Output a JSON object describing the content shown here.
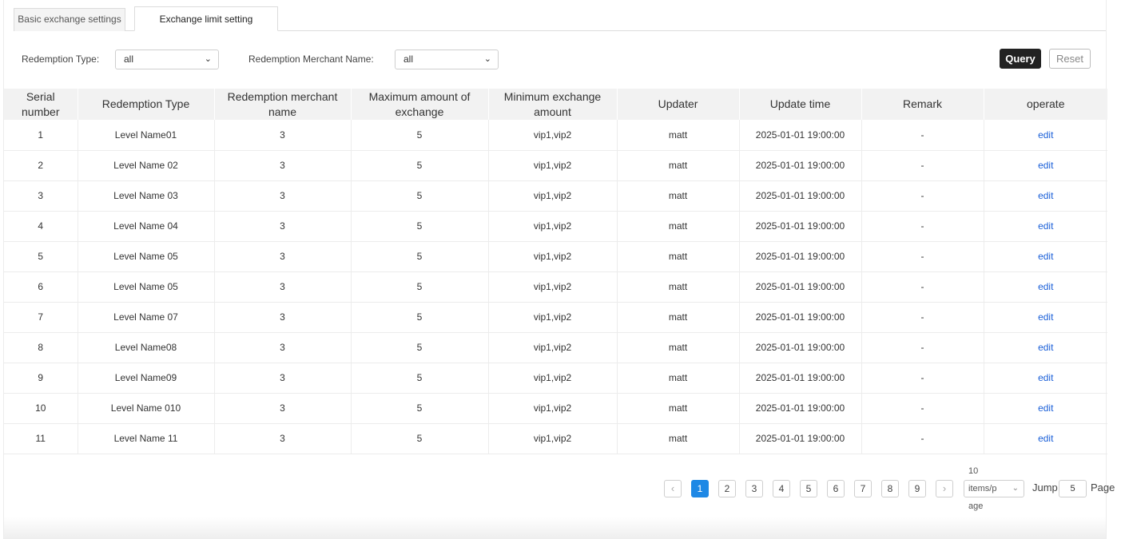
{
  "tabs": [
    {
      "label": "Basic exchange settings",
      "active": false
    },
    {
      "label": "Exchange limit setting",
      "active": true
    }
  ],
  "filters": {
    "redemption_type_label": "Redemption Type:",
    "redemption_type_value": "all",
    "merchant_name_label": "Redemption Merchant Name:",
    "merchant_name_value": "all",
    "query_label": "Query",
    "reset_label": "Reset"
  },
  "table": {
    "columns": [
      "Serial number",
      "Redemption Type",
      "Redemption merchant name",
      "Maximum amount of exchange",
      "Minimum exchange amount",
      "Updater",
      "Update time",
      "Remark",
      "operate"
    ],
    "rows": [
      [
        "1",
        "Level Name01",
        "3",
        "5",
        "vip1,vip2",
        "matt",
        "2025-01-01 19:00:00",
        "-",
        "edit"
      ],
      [
        "2",
        "Level Name 02",
        "3",
        "5",
        "vip1,vip2",
        "matt",
        "2025-01-01 19:00:00",
        "-",
        "edit"
      ],
      [
        "3",
        "Level Name 03",
        "3",
        "5",
        "vip1,vip2",
        "matt",
        "2025-01-01 19:00:00",
        "-",
        "edit"
      ],
      [
        "4",
        "Level Name 04",
        "3",
        "5",
        "vip1,vip2",
        "matt",
        "2025-01-01 19:00:00",
        "-",
        "edit"
      ],
      [
        "5",
        "Level Name 05",
        "3",
        "5",
        "vip1,vip2",
        "matt",
        "2025-01-01 19:00:00",
        "-",
        "edit"
      ],
      [
        "6",
        "Level Name 05",
        "3",
        "5",
        "vip1,vip2",
        "matt",
        "2025-01-01 19:00:00",
        "-",
        "edit"
      ],
      [
        "7",
        "Level Name 07",
        "3",
        "5",
        "vip1,vip2",
        "matt",
        "2025-01-01 19:00:00",
        "-",
        "edit"
      ],
      [
        "8",
        "Level Name08",
        "3",
        "5",
        "vip1,vip2",
        "matt",
        "2025-01-01 19:00:00",
        "-",
        "edit"
      ],
      [
        "9",
        "Level Name09",
        "3",
        "5",
        "vip1,vip2",
        "matt",
        "2025-01-01 19:00:00",
        "-",
        "edit"
      ],
      [
        "10",
        "Level Name 010",
        "3",
        "5",
        "vip1,vip2",
        "matt",
        "2025-01-01 19:00:00",
        "-",
        "edit"
      ],
      [
        "11",
        "Level Name 11",
        "3",
        "5",
        "vip1,vip2",
        "matt",
        "2025-01-01 19:00:00",
        "-",
        "edit"
      ]
    ]
  },
  "pagination": {
    "prev_icon": "chevron-left-icon",
    "next_icon": "chevron-right-icon",
    "pages": [
      "1",
      "2",
      "3",
      "4",
      "5",
      "6",
      "7",
      "8",
      "9"
    ],
    "current_page": "1",
    "page_size_top": "10",
    "page_size_mid": "items/p",
    "page_size_bottom": "age",
    "jump_label": "Jump",
    "jump_value": "5",
    "page_label": "Page"
  },
  "colors": {
    "accent": "#1e88e5",
    "link": "#1a5fd8",
    "query_button": "#222222"
  }
}
